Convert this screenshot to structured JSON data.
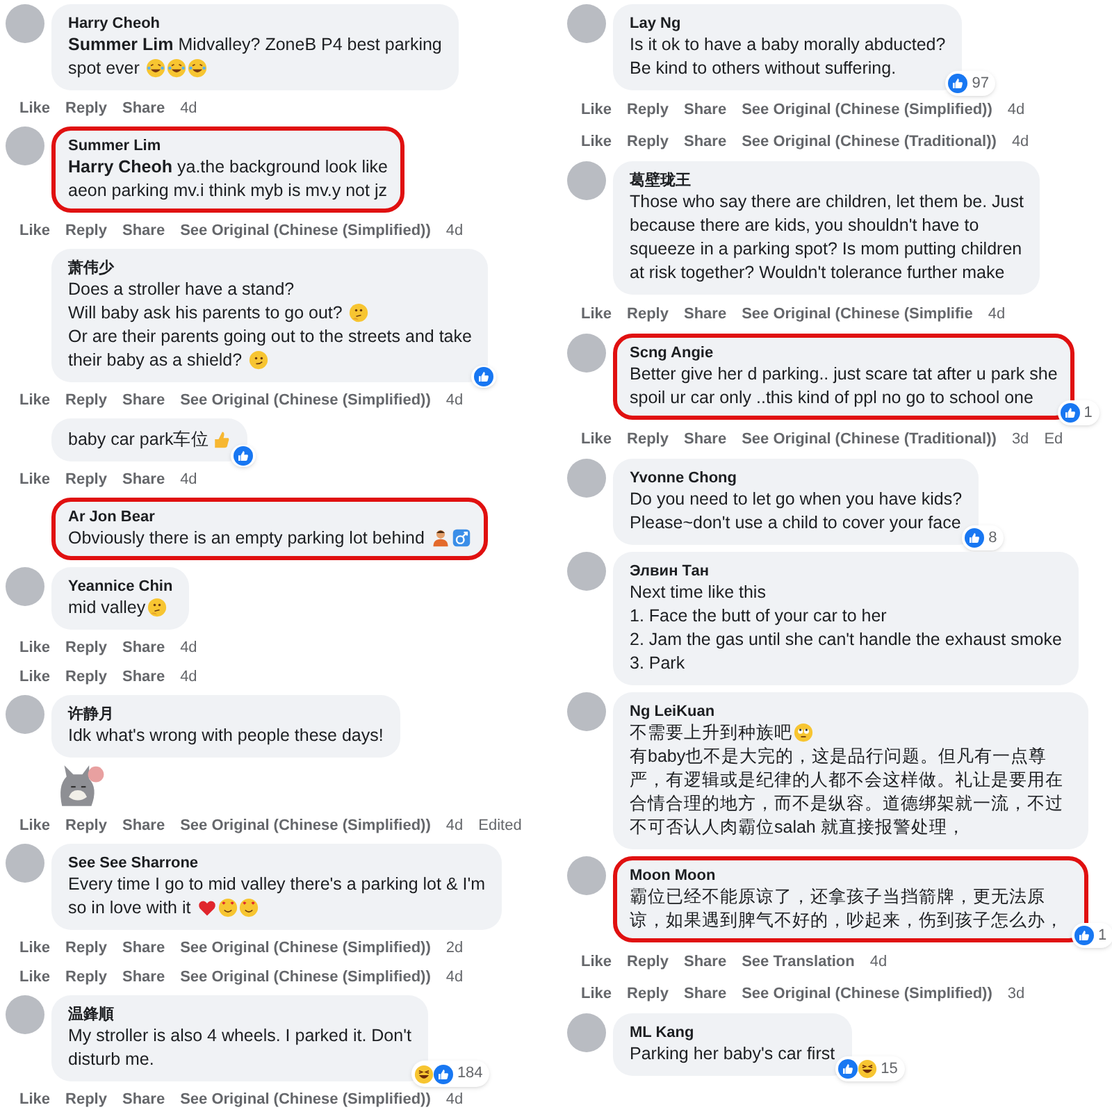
{
  "columns": [
    {
      "items": [
        {
          "kind": "comment",
          "name": "Harry Cheoh",
          "avatar": true,
          "highlighted": false,
          "body": [
            {
              "kind": "text",
              "text": "**Summer Lim** Midvalley? ZoneB P4 best parking\nspot ever "
            },
            {
              "kind": "laugh-emoji"
            },
            {
              "kind": "laugh-emoji"
            },
            {
              "kind": "laugh-emoji"
            }
          ]
        },
        {
          "kind": "actions",
          "actions": [
            "Like",
            "Reply",
            "Share"
          ],
          "time": "4d"
        },
        {
          "kind": "comment",
          "name": "Summer Lim",
          "avatar": true,
          "highlighted": true,
          "body": [
            {
              "kind": "text",
              "text": "**Harry Cheoh** ya.the background look like\naeon parking mv.i think myb is mv.y not jz"
            }
          ]
        },
        {
          "kind": "actions",
          "actions": [
            "Like",
            "Reply",
            "Share",
            "See Original (Chinese (Simplified))"
          ],
          "time": "4d"
        },
        {
          "kind": "comment",
          "name": "萧伟少",
          "avatar": false,
          "highlighted": false,
          "body": [
            {
              "kind": "text",
              "text": "Does a stroller have a stand?\nWill baby ask his parents to go out? "
            },
            {
              "kind": "thinking-emoji"
            },
            {
              "kind": "text",
              "text": "\nOr are their parents going out to the streets and take\ntheir baby as a shield? "
            },
            {
              "kind": "smirk-emoji"
            }
          ],
          "reaction": {
            "icons": [
              {
                "kind": "like"
              }
            ]
          }
        },
        {
          "kind": "actions",
          "actions": [
            "Like",
            "Reply",
            "Share",
            "See Original (Chinese (Simplified))"
          ],
          "time": "4d"
        },
        {
          "kind": "comment",
          "avatar": false,
          "highlighted": false,
          "body": [
            {
              "kind": "text",
              "text": "baby car park车位"
            },
            {
              "kind": "thumbs-up-emoji"
            }
          ],
          "reaction": {
            "icons": [
              {
                "kind": "like"
              }
            ]
          }
        },
        {
          "kind": "actions",
          "actions": [
            "Like",
            "Reply",
            "Share"
          ],
          "time": "4d"
        },
        {
          "kind": "comment",
          "name": "Ar Jon Bear",
          "avatar": false,
          "highlighted": true,
          "body": [
            {
              "kind": "text",
              "text": "Obviously there is an empty parking lot behind "
            },
            {
              "kind": "person-emoji"
            },
            {
              "kind": "male-sign-emoji"
            }
          ]
        },
        {
          "kind": "comment",
          "name": "Yeannice Chin",
          "avatar": true,
          "highlighted": false,
          "body": [
            {
              "kind": "text",
              "text": "mid valley"
            },
            {
              "kind": "thinking-emoji"
            }
          ]
        },
        {
          "kind": "actions",
          "actions": [
            "Like",
            "Reply",
            "Share"
          ],
          "time": "4d"
        },
        {
          "kind": "actions",
          "actions": [
            "Like",
            "Reply",
            "Share"
          ],
          "time": "4d"
        },
        {
          "kind": "comment",
          "name": "许静月",
          "avatar": true,
          "highlighted": false,
          "body": [
            {
              "kind": "text",
              "text": "Idk what's wrong with people these days!"
            }
          ]
        },
        {
          "kind": "sticker"
        },
        {
          "kind": "actions",
          "actions": [
            "Like",
            "Reply",
            "Share",
            "See Original (Chinese (Simplified))"
          ],
          "time": "4d",
          "note": "Edited"
        },
        {
          "kind": "comment",
          "name": "See See Sharrone",
          "avatar": true,
          "highlighted": false,
          "body": [
            {
              "kind": "text",
              "text": "Every time I go to mid valley there's a parking lot & I'm\nso in love with it "
            },
            {
              "kind": "heart-emoji"
            },
            {
              "kind": "love-face-emoji"
            },
            {
              "kind": "love-face-emoji"
            }
          ]
        },
        {
          "kind": "actions",
          "actions": [
            "Like",
            "Reply",
            "Share",
            "See Original (Chinese (Simplified))"
          ],
          "time": "2d"
        },
        {
          "kind": "actions",
          "actions": [
            "Like",
            "Reply",
            "Share",
            "See Original (Chinese (Simplified))"
          ],
          "time": "4d"
        },
        {
          "kind": "comment",
          "name": "温鋒順",
          "avatar": true,
          "highlighted": false,
          "body": [
            {
              "kind": "text",
              "text": "My stroller is also 4 wheels. I parked it. Don't\ndisturb me."
            }
          ],
          "reaction": {
            "icons": [
              {
                "kind": "haha"
              },
              {
                "kind": "like"
              }
            ],
            "count": "184"
          }
        },
        {
          "kind": "actions",
          "actions": [
            "Like",
            "Reply",
            "Share",
            "See Original (Chinese (Simplified))"
          ],
          "time": "4d"
        }
      ]
    },
    {
      "items": [
        {
          "kind": "comment",
          "name": "Lay Ng",
          "avatar": true,
          "highlighted": false,
          "body": [
            {
              "kind": "text",
              "text": "Is it ok to have a baby morally abducted?\nBe kind to others without suffering."
            }
          ],
          "reaction": {
            "icons": [
              {
                "kind": "like"
              }
            ],
            "count": "97"
          }
        },
        {
          "kind": "actions",
          "actions": [
            "Like",
            "Reply",
            "Share",
            "See Original (Chinese (Simplified))"
          ],
          "time": "4d"
        },
        {
          "kind": "actions",
          "actions": [
            "Like",
            "Reply",
            "Share",
            "See Original (Chinese (Traditional))"
          ],
          "time": "4d"
        },
        {
          "kind": "comment",
          "name": "葛壁珑王",
          "avatar": true,
          "highlighted": false,
          "body": [
            {
              "kind": "text",
              "text": "Those who say there are children, let them be. Just\nbecause there are kids, you shouldn't have to\nsqueeze in a parking spot? Is mom putting children\nat risk together? Wouldn't tolerance further make"
            }
          ]
        },
        {
          "kind": "actions",
          "actions": [
            "Like",
            "Reply",
            "Share",
            "See Original (Chinese (Simplifie"
          ],
          "time": "4d"
        },
        {
          "kind": "comment",
          "name": "Scng Angie",
          "avatar": true,
          "highlighted": true,
          "body": [
            {
              "kind": "text",
              "text": "Better give her d parking.. just scare tat after u park she\nspoil ur car only ..this kind of ppl no go to school one"
            }
          ],
          "reaction": {
            "icons": [
              {
                "kind": "like"
              }
            ],
            "count": "1"
          }
        },
        {
          "kind": "actions",
          "actions": [
            "Like",
            "Reply",
            "Share",
            "See Original (Chinese (Traditional))"
          ],
          "time": "3d",
          "note": "Ed"
        },
        {
          "kind": "comment",
          "name": "Yvonne Chong",
          "avatar": true,
          "highlighted": false,
          "body": [
            {
              "kind": "text",
              "text": "Do you need to let go when you have kids?\nPlease~don't use a child to cover your face"
            }
          ],
          "reaction": {
            "icons": [
              {
                "kind": "like"
              }
            ],
            "count": "8"
          }
        },
        {
          "kind": "comment",
          "name": "Элвин Тан",
          "avatar": true,
          "highlighted": false,
          "body": [
            {
              "kind": "text",
              "text": "Next time like this\n1. Face the butt of your car to her\n2. Jam the gas until she can't handle the exhaust smoke\n3. Park"
            }
          ]
        },
        {
          "kind": "comment",
          "name": "Ng LeiKuan",
          "avatar": true,
          "highlighted": false,
          "body": [
            {
              "kind": "text",
              "text": "不需要上升到种族吧"
            },
            {
              "kind": "eye-roll-emoji"
            },
            {
              "kind": "text",
              "text": "\n有baby也不是大完的，这是品行问题。但凡有一点尊严，有逻辑或是纪律的人都不会这样做。礼让是要用在合情合理的地方，而不是纵容。道德绑架就一流，不过不可否认人肉霸位salah 就直接报警处理，"
            }
          ]
        },
        {
          "kind": "comment",
          "name": "Moon Moon",
          "avatar": true,
          "highlighted": true,
          "body": [
            {
              "kind": "text",
              "text": "霸位已经不能原谅了，还拿孩子当挡箭牌，更无法原谅，如果遇到脾气不好的，吵起来，伤到孩子怎么办，"
            }
          ],
          "reaction": {
            "icons": [
              {
                "kind": "like"
              }
            ],
            "count": "1"
          }
        },
        {
          "kind": "actions",
          "actions": [
            "Like",
            "Reply",
            "Share",
            "See Translation"
          ],
          "time": "4d"
        },
        {
          "kind": "actions",
          "actions": [
            "Like",
            "Reply",
            "Share",
            "See Original (Chinese (Simplified))"
          ],
          "time": "3d"
        },
        {
          "kind": "comment",
          "name": "ML Kang",
          "avatar": true,
          "highlighted": false,
          "body": [
            {
              "kind": "text",
              "text": "Parking her baby's car first"
            }
          ],
          "reaction": {
            "icons": [
              {
                "kind": "like"
              },
              {
                "kind": "haha"
              }
            ],
            "count": "15"
          }
        }
      ]
    }
  ]
}
